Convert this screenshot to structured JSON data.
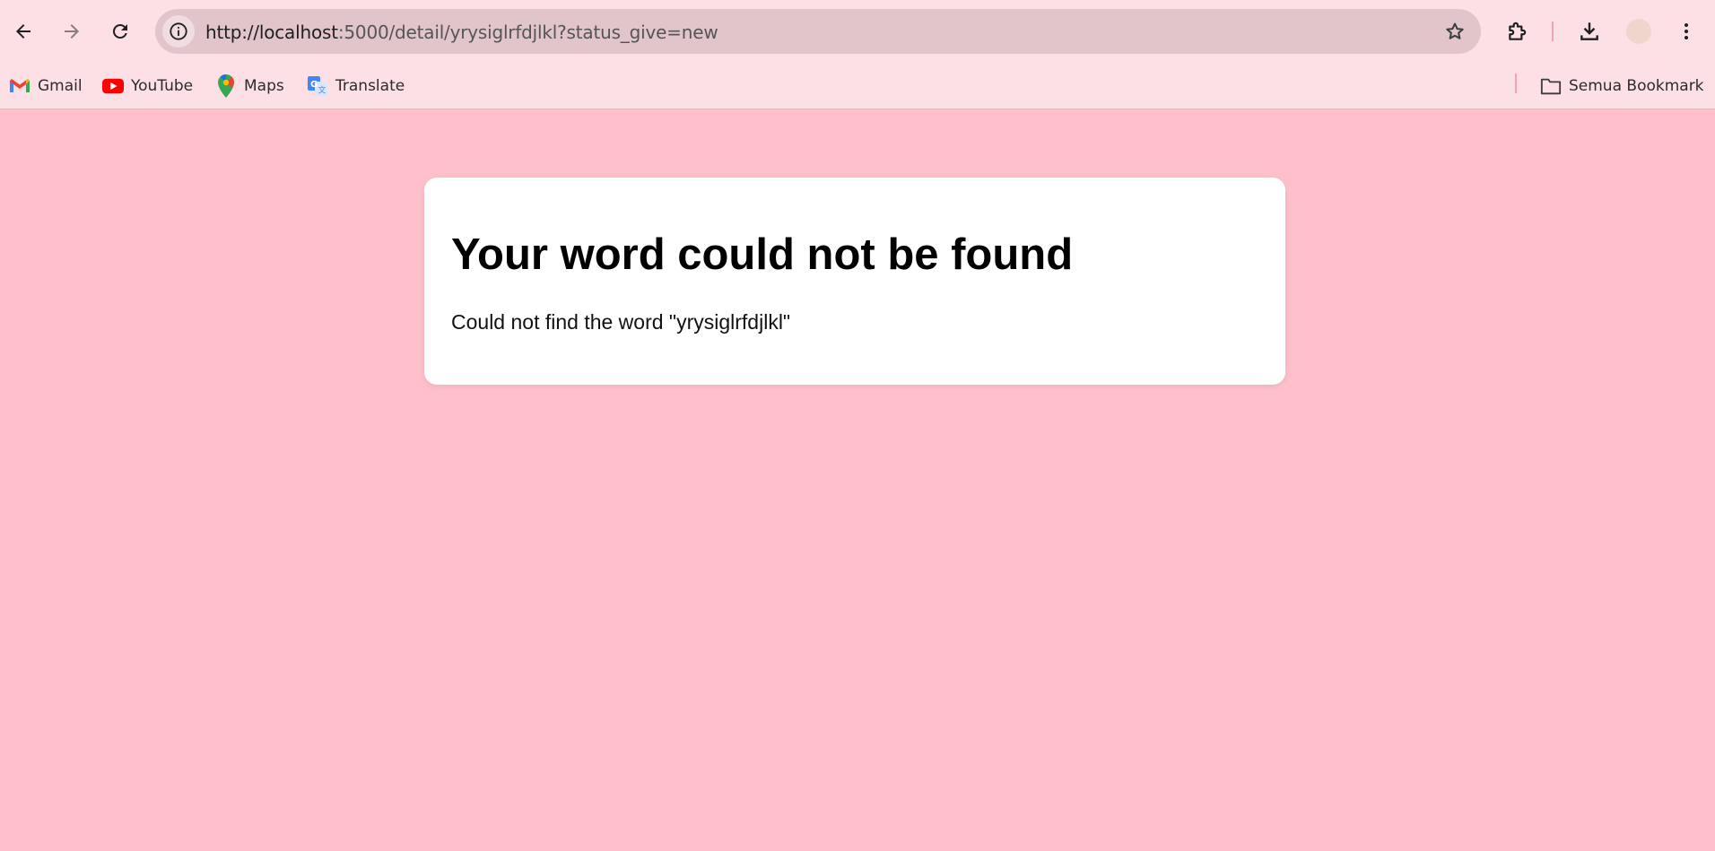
{
  "browser": {
    "url_host": "http://localhost",
    "url_rest": ":5000/detail/yrysiglrfdjlkl?status_give=new",
    "bookmarks": [
      {
        "label": "Gmail",
        "icon": "gmail-icon"
      },
      {
        "label": "YouTube",
        "icon": "youtube-icon"
      },
      {
        "label": "Maps",
        "icon": "maps-icon"
      },
      {
        "label": "Translate",
        "icon": "translate-icon"
      }
    ],
    "all_bookmarks_label": "Semua Bookmark",
    "theme_color": "#fde0e6"
  },
  "page": {
    "background": "#ffc0cb",
    "heading": "Your word could not be found",
    "message": "Could not find the word \"yrysiglrfdjlkl\""
  }
}
